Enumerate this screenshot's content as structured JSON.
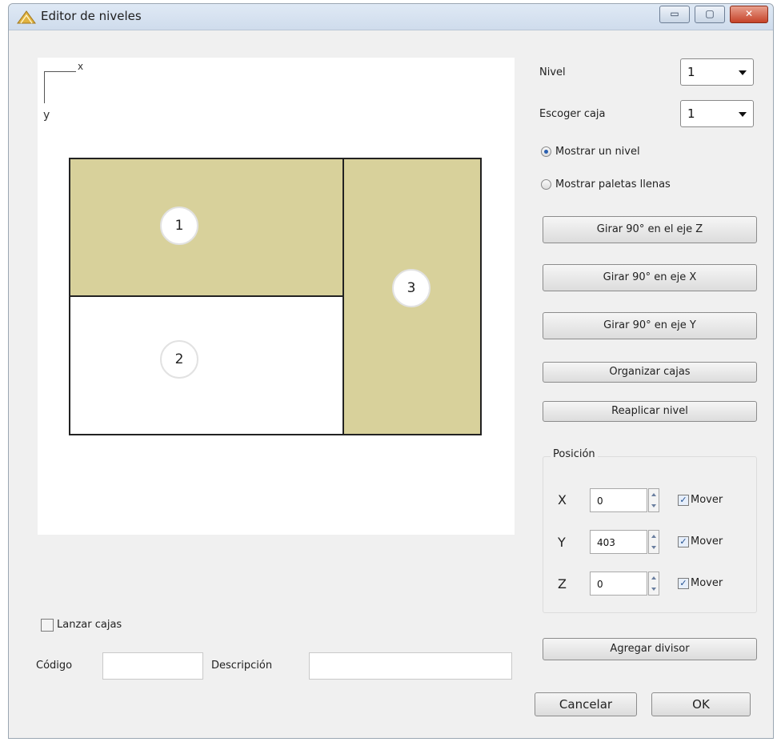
{
  "window": {
    "title": "Editor de niveles",
    "min_glyph": "▭",
    "max_glyph": "▢",
    "close_glyph": "✕"
  },
  "canvas": {
    "axis_x": "x",
    "axis_y": "y",
    "boxes": [
      {
        "label": "1",
        "color": "#d8d19b"
      },
      {
        "label": "2",
        "color": "#ffffff"
      },
      {
        "label": "3",
        "color": "#d8d19b"
      }
    ]
  },
  "controls": {
    "nivel_label": "Nivel",
    "nivel_value": "1",
    "escoger_label": "Escoger caja",
    "escoger_value": "1",
    "radio_show_level": "Mostrar un nivel",
    "radio_show_full": "Mostrar paletas llenas",
    "btn_rotate_z": "Girar 90° en el eje Z",
    "btn_rotate_x": "Girar 90° en eje X",
    "btn_rotate_y": "Girar 90° en eje Y",
    "btn_organize": "Organizar cajas",
    "btn_reapply": "Reaplicar nivel"
  },
  "posicion": {
    "title": "Posición",
    "x_label": "X",
    "x_value": "0",
    "y_label": "Y",
    "y_value": "403",
    "z_label": "Z",
    "z_value": "0",
    "mover_label": "Mover",
    "check_glyph": "✓"
  },
  "bottom": {
    "lanzar_label": "Lanzar cajas",
    "codigo_label": "Código",
    "descripcion_label": "Descripción",
    "btn_add_divider": "Agregar divisor",
    "btn_cancel": "Cancelar",
    "btn_ok": "OK"
  }
}
